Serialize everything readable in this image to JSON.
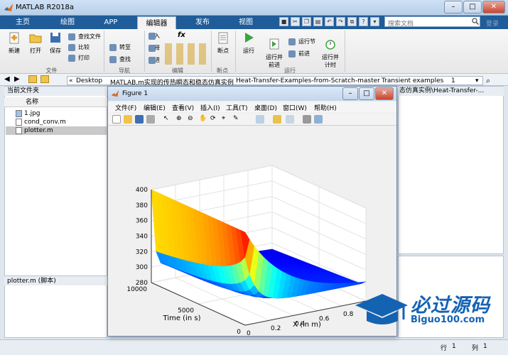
{
  "app": {
    "title": "MATLAB R2018a"
  },
  "window_controls": {
    "minimize": "–",
    "maximize": "□",
    "close": "✕"
  },
  "ribbon_tabs": [
    {
      "label": "主页"
    },
    {
      "label": "绘图"
    },
    {
      "label": "APP"
    },
    {
      "label": "编辑器"
    },
    {
      "label": "发布"
    },
    {
      "label": "视图"
    }
  ],
  "search": {
    "placeholder": "搜索文档"
  },
  "login": "登录",
  "ribbon": {
    "file_group": {
      "label": "文件",
      "new": "新建",
      "open": "打开",
      "save": "保存",
      "find_files": "查找文件",
      "compare": "比较",
      "print": "打印"
    },
    "nav_group": {
      "label": "导航",
      "goto": "转至",
      "find": "查找"
    },
    "edit_group": {
      "label": "编辑",
      "insert": "插入",
      "comment": "注释",
      "indent": "缩进",
      "fx": "fx"
    },
    "breakpoint_group": {
      "label": "断点",
      "breakpoints": "断点"
    },
    "run_group": {
      "label": "运行",
      "run": "运行",
      "run_advance": "运行并\n前进",
      "run_section": "运行节",
      "advance": "前进",
      "run_time": "运行并\n计时"
    }
  },
  "address": {
    "prefix": "«",
    "crumbs": [
      "Desktop",
      "MATLAB.m实现的传热瞬态和稳态仿真实例",
      "Heat-Transfer-Examples-from-Scratch-master",
      "Transient examples",
      "1"
    ]
  },
  "current_folder": {
    "title": "当前文件夹",
    "column_name": "名称",
    "files": [
      {
        "name": "1.jpg",
        "selected": false
      },
      {
        "name": "cond_conv.m",
        "selected": false
      },
      {
        "name": "plotter.m",
        "selected": true
      }
    ],
    "details": "plotter.m  (脚本)"
  },
  "editor_tab": {
    "title": "态仿真实例\\Heat-Transfer-..."
  },
  "status": {
    "row_label": "行",
    "row": "1",
    "col_label": "列",
    "col": "1"
  },
  "figure": {
    "title": "Figure 1",
    "menus": [
      "文件(F)",
      "编辑(E)",
      "查看(V)",
      "插入(I)",
      "工具(T)",
      "桌面(D)",
      "窗口(W)",
      "帮助(H)"
    ]
  },
  "chart_data": {
    "type": "surface",
    "xlabel": "X (in m)",
    "ylabel": "Time (in s)",
    "zlabel": "",
    "x_ticks": [
      0,
      0.2,
      0.4,
      0.6,
      0.8,
      1
    ],
    "y_ticks": [
      0,
      5000,
      10000
    ],
    "z_ticks": [
      280,
      300,
      320,
      340,
      360,
      380,
      400
    ],
    "xlim": [
      0,
      1
    ],
    "ylim": [
      0,
      10000
    ],
    "zlim": [
      280,
      400
    ],
    "grid": true,
    "colormap": "jet",
    "description_series": [
      {
        "name": "",
        "values": [
          400,
          372,
          352,
          344,
          342
        ]
      }
    ]
  },
  "watermark": {
    "text": "必过源码",
    "url": "Biguo100.com"
  },
  "colors": {
    "tab_bar": "#1f5c99",
    "accent": "#1463b3"
  }
}
